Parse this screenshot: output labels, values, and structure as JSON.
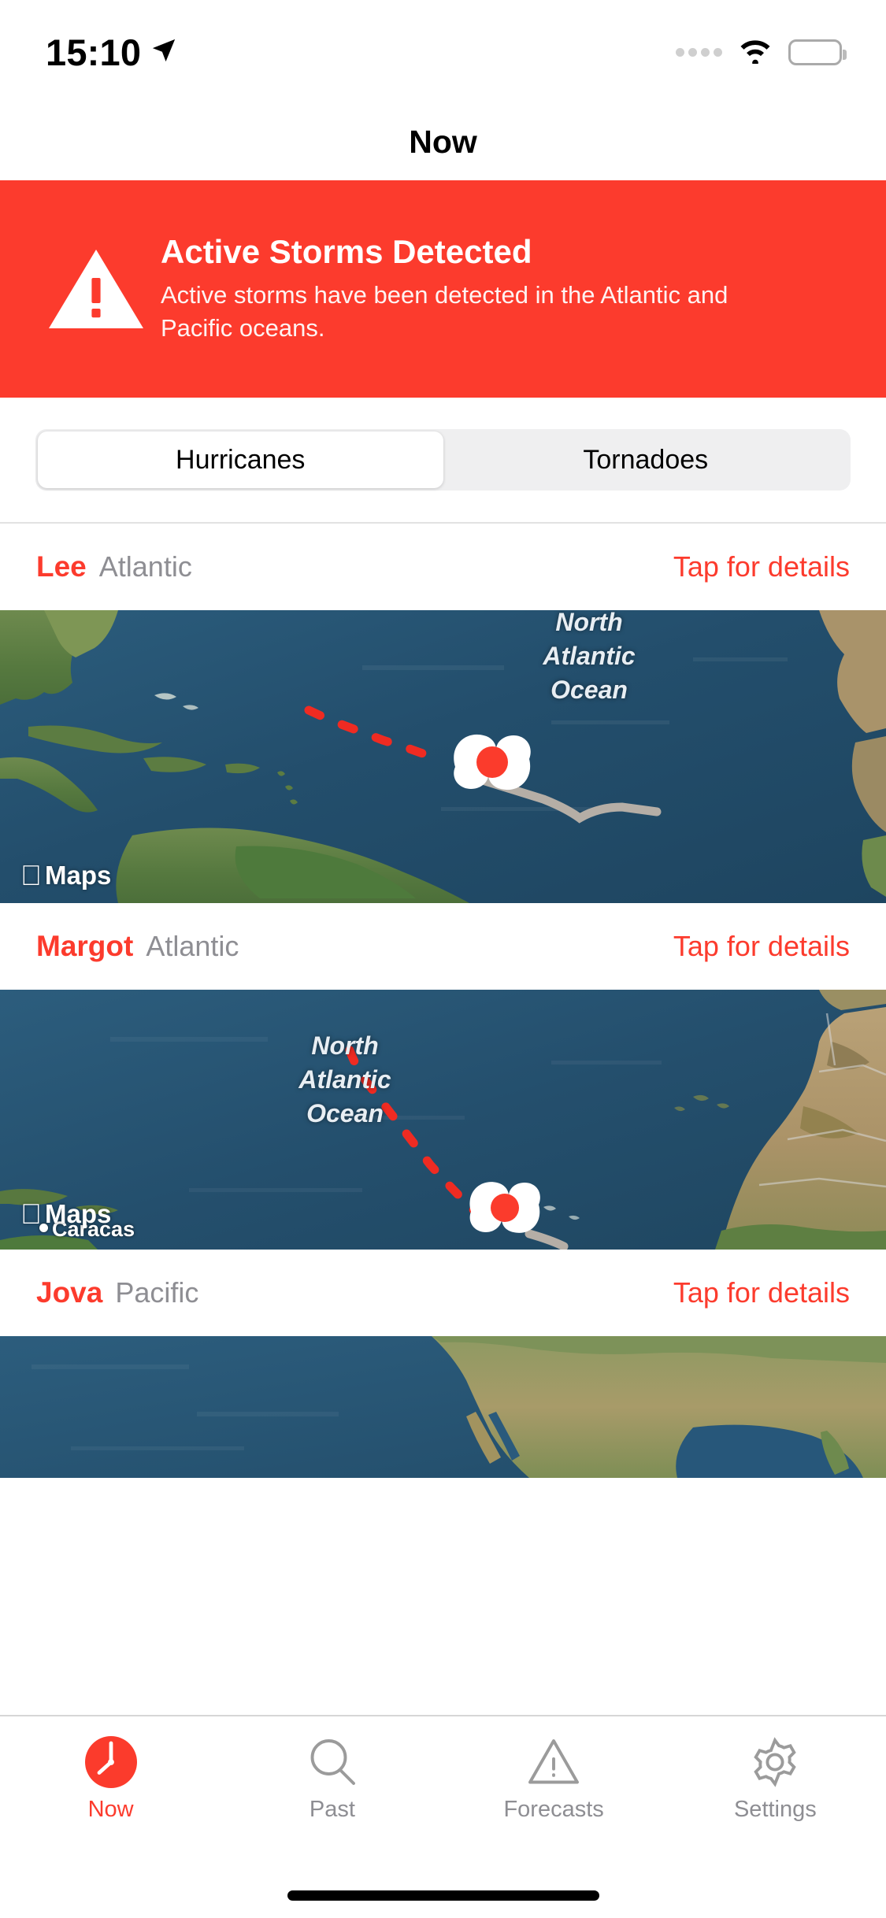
{
  "status_bar": {
    "time": "15:10",
    "location_icon": "location-arrow-icon",
    "signal_icon": "cellular-dots-icon",
    "wifi_icon": "wifi-icon",
    "battery_icon": "battery-full-icon"
  },
  "header": {
    "title": "Now"
  },
  "alert": {
    "icon": "warning-triangle-icon",
    "title": "Active Storms Detected",
    "message": "Active storms have been detected in the Atlantic and Pacific oceans.",
    "background_color": "#fc3b2d"
  },
  "segmented_control": {
    "options": [
      "Hurricanes",
      "Tornadoes"
    ],
    "selected": "Hurricanes"
  },
  "storms": [
    {
      "name": "Lee",
      "basin": "Atlantic",
      "details_link": "Tap for details",
      "map": {
        "attribution": "Maps",
        "ocean_label": "North\nAtlantic\nOcean",
        "marker": "hurricane-symbol-icon",
        "city_label": ""
      }
    },
    {
      "name": "Margot",
      "basin": "Atlantic",
      "details_link": "Tap for details",
      "map": {
        "attribution": "Maps",
        "ocean_label": "North\nAtlantic\nOcean",
        "marker": "hurricane-symbol-icon",
        "city_label": "Caracas"
      }
    },
    {
      "name": "Jova",
      "basin": "Pacific",
      "details_link": "Tap for details",
      "map": {
        "attribution": "",
        "ocean_label": "",
        "marker": "hurricane-symbol-icon",
        "city_label": ""
      }
    }
  ],
  "tab_bar": {
    "items": [
      {
        "label": "Now",
        "icon": "clock-icon",
        "active": true
      },
      {
        "label": "Past",
        "icon": "magnifier-icon",
        "active": false
      },
      {
        "label": "Forecasts",
        "icon": "warning-triangle-outline-icon",
        "active": false
      },
      {
        "label": "Settings",
        "icon": "gear-icon",
        "active": false
      }
    ],
    "accent_color": "#fc3b2d",
    "inactive_color": "#8e8e93"
  }
}
